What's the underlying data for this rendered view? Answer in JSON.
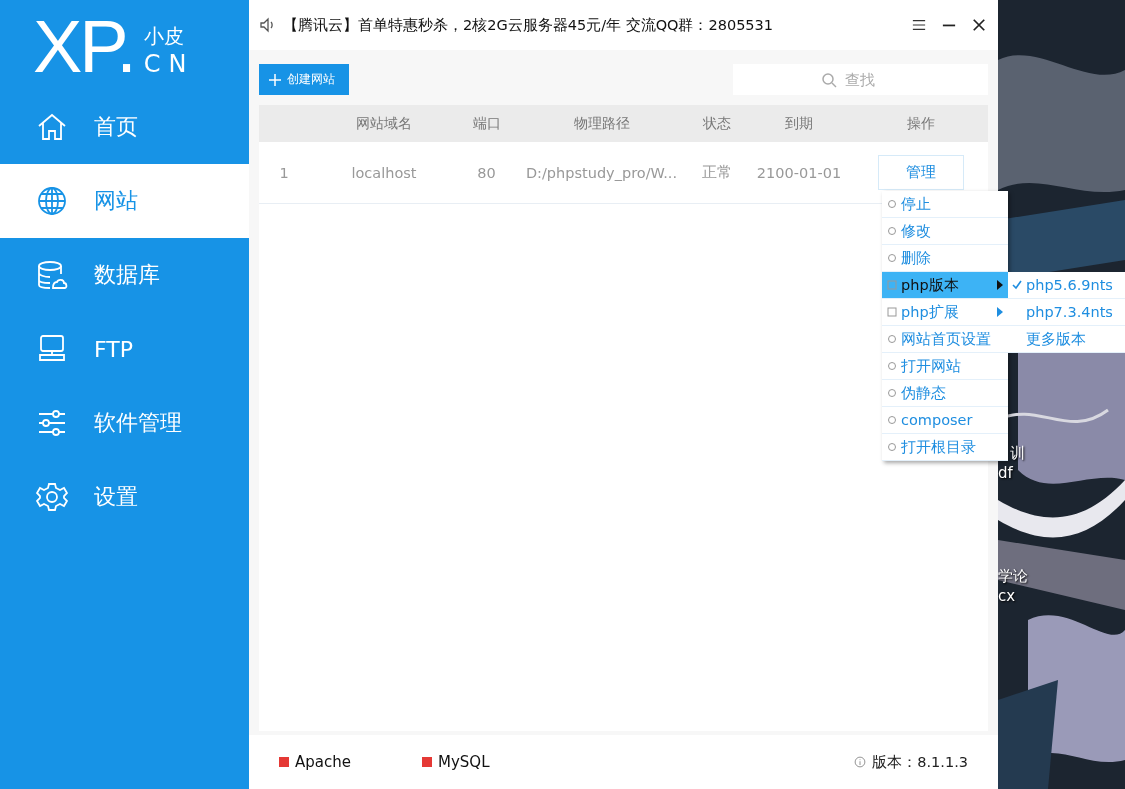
{
  "sidebar": {
    "logo": {
      "mark": "XP.",
      "sub_top": "小皮",
      "sub_bottom": "CN"
    },
    "items": [
      {
        "label": "首页",
        "selected": false
      },
      {
        "label": "网站",
        "selected": true
      },
      {
        "label": "数据库",
        "selected": false
      },
      {
        "label": "FTP",
        "selected": false
      },
      {
        "label": "软件管理",
        "selected": false
      },
      {
        "label": "设置",
        "selected": false
      }
    ]
  },
  "title_bar": {
    "notice": "【腾讯云】首单特惠秒杀，2核2G云服务器45元/年 交流QQ群：2805531"
  },
  "toolbar": {
    "create_button": "创建网站",
    "search": {
      "placeholder": "查找"
    }
  },
  "table": {
    "columns": [
      "",
      "网站域名",
      "端口",
      "物理路径",
      "状态",
      "到期",
      "操作"
    ],
    "rows": [
      {
        "cells": [
          "1",
          "localhost",
          "80",
          "D:/phpstudy_pro/W...",
          "正常",
          "2100-01-01"
        ],
        "action": "管理"
      }
    ]
  },
  "context_menu": {
    "items": [
      {
        "label": "停止",
        "selected": false,
        "submenu": false
      },
      {
        "label": "修改",
        "selected": false,
        "submenu": false
      },
      {
        "label": "删除",
        "selected": false,
        "submenu": false
      },
      {
        "label": "php版本",
        "selected": true,
        "submenu": true
      },
      {
        "label": "php扩展",
        "selected": false,
        "submenu": true
      },
      {
        "label": "网站首页设置",
        "selected": false,
        "submenu": false
      },
      {
        "label": "打开网站",
        "selected": false,
        "submenu": false
      },
      {
        "label": "伪静态",
        "selected": false,
        "submenu": false
      },
      {
        "label": "composer",
        "selected": false,
        "submenu": false
      },
      {
        "label": "打开根目录",
        "selected": false,
        "submenu": false
      }
    ],
    "submenu": [
      {
        "label": "php5.6.9nts",
        "checked": true
      },
      {
        "label": "php7.3.4nts",
        "checked": false
      },
      {
        "label": "更多版本",
        "checked": false
      }
    ]
  },
  "status_bar": {
    "services": [
      {
        "name": "Apache",
        "color": "#e53935"
      },
      {
        "name": "MySQL",
        "color": "#e53935"
      }
    ],
    "version": "版本：8.1.1.3"
  },
  "desktop": {
    "labels": [
      {
        "text": "训"
      },
      {
        "text": "df"
      },
      {
        "text": "学论"
      },
      {
        "text": "cx"
      }
    ]
  }
}
